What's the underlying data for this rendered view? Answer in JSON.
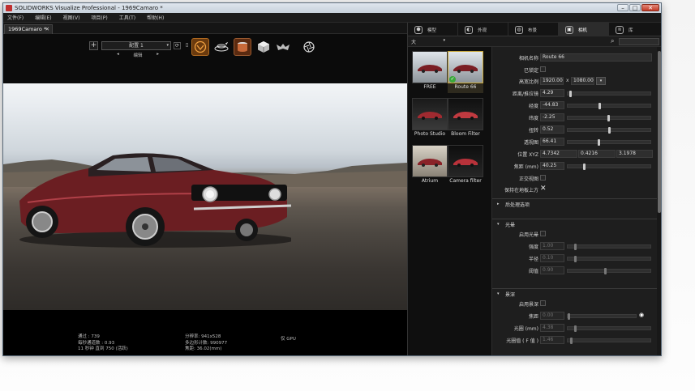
{
  "window": {
    "title": "SOLIDWORKS Visualize Professional - 1969Camaro *",
    "btn_min": "–",
    "btn_max": "□",
    "btn_close": "✕"
  },
  "menu": [
    "文件(F)",
    "编辑(E)",
    "视图(V)",
    "项目(P)",
    "工具(T)",
    "帮助(H)"
  ],
  "doc_tab": {
    "label": "1969Camaro *",
    "close": "✕"
  },
  "toolbar": {
    "add": "+",
    "config": "配置 1",
    "config_arrow": "▾",
    "prev": "◂",
    "edit": "编辑",
    "next": "▸"
  },
  "status": {
    "col1": [
      "通过 : 739",
      "每秒通道数 : 0.93",
      "11 秒钟 直到 750 (活跃)"
    ],
    "col2": [
      "分辨率: 941x528",
      "多边形计数: 990977",
      "焦距: 36.02(mm)"
    ],
    "col3": [
      "仅 GPU"
    ]
  },
  "right_tabs": [
    {
      "label": "模型",
      "icon": "⬢"
    },
    {
      "label": "外观",
      "icon": "◐"
    },
    {
      "label": "布景",
      "icon": "◍"
    },
    {
      "label": "相机",
      "icon": "▣"
    },
    {
      "label": "库",
      "icon": "≋"
    }
  ],
  "size_select": {
    "value": "大",
    "arrow": "▾"
  },
  "search_icon": "⌕",
  "cameras": [
    {
      "label": "FREE"
    },
    {
      "label": "Route 66"
    },
    {
      "label": "Photo Studio"
    },
    {
      "label": "Bloom Filter"
    },
    {
      "label": "Atrium"
    },
    {
      "label": "Camera filter"
    }
  ],
  "check": "✓",
  "props": {
    "camera_name_label": "相机名称",
    "camera_name": "Route 66",
    "locked_label": "已锁定",
    "aspect_label": "高宽比例",
    "aspect_w": "1920.00",
    "aspect_x": "x",
    "aspect_h": "1080.00",
    "aspect_dd": "▾",
    "distance_label": "距离/推拉镜",
    "distance": "4.29",
    "longitude_label": "经度",
    "longitude": "-44.83",
    "latitude_label": "纬度",
    "latitude": "-2.25",
    "twist_label": "扭转",
    "twist": "0.52",
    "perspective_label": "透视图",
    "perspective": "66.41",
    "position_label": "位置 XYZ",
    "pos_x": "4.7342",
    "pos_y": "0.4216",
    "pos_z": "3.1978",
    "focal_label": "焦距 (mm)",
    "focal": "40.25",
    "ortho_label": "正交视图",
    "keep_above_label": "保持在地板上方",
    "keep_above_mark": "✕",
    "post_section": "后处理选项",
    "post_tri": "▸",
    "bloom_section": "光晕",
    "bloom_tri": "▾",
    "enable_bloom_label": "启用光晕",
    "intensity_label": "强度",
    "intensity": "1.00",
    "radius_label": "半径",
    "radius": "0.10",
    "threshold_label": "阈值",
    "threshold": "0.90",
    "dof_section": "景深",
    "dof_tri": "▾",
    "enable_dof_label": "启用景深",
    "focus_label": "焦距",
    "focus": "0.00",
    "eye": "◉",
    "aperture_label": "光圈 (mm)",
    "aperture": "4.38",
    "fstop_label": "光圈值 ( F 值 )",
    "fstop": "1.46"
  },
  "sliders": {
    "distance": 0.02,
    "longitude": 0.38,
    "latitude": 0.49,
    "twist": 0.5,
    "perspective": 0.37,
    "focal": 0.19,
    "intensity": 0.08,
    "radius": 0.08,
    "threshold": 0.45,
    "focus": 0.0,
    "aperture": 0.08,
    "fstop": 0.03
  },
  "colors": {
    "accent_gold": "#c9a838",
    "check_green": "#3aa83a",
    "car_red": "#6b1e22"
  }
}
